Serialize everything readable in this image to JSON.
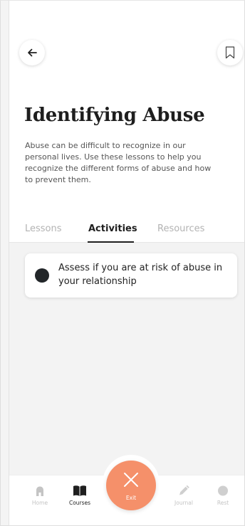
{
  "header": {
    "back_icon": "arrow-left-icon",
    "bookmark_icon": "bookmark-icon"
  },
  "page": {
    "title": "Identifying Abuse",
    "description": "Abuse can be difficult to recognize in our personal lives. Use these lessons to help you recognize the different forms of abuse and how to prevent them."
  },
  "tabs": {
    "items": [
      {
        "label": "Lessons",
        "active": false
      },
      {
        "label": "Activities",
        "active": true
      },
      {
        "label": "Resources",
        "active": false
      }
    ]
  },
  "activities": [
    {
      "label": "Assess if you are at risk of abuse in your relationship",
      "icon": "bullet-dot-icon"
    }
  ],
  "bottom_nav": {
    "items": [
      {
        "label": "Home",
        "icon": "home-icon",
        "active": false
      },
      {
        "label": "Courses",
        "icon": "book-icon",
        "active": true
      },
      {
        "label": "Exit",
        "icon": "close-icon",
        "active": false
      },
      {
        "label": "Journal",
        "icon": "pencil-icon",
        "active": false
      },
      {
        "label": "Rest",
        "icon": "moon-icon",
        "active": false
      }
    ]
  },
  "colors": {
    "accent": "#f5906a",
    "text_primary": "#1e1e1e",
    "text_muted": "#b3b3b3",
    "background_area": "#f3f3f3",
    "dot": "#222629"
  }
}
